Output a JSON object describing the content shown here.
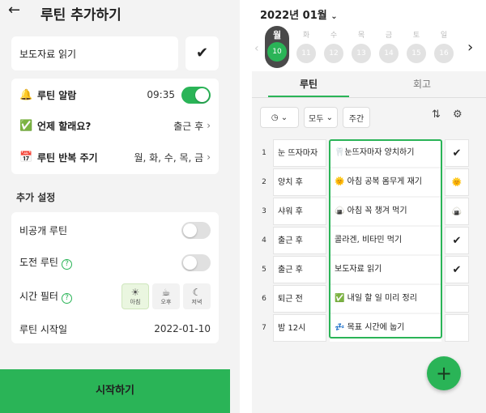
{
  "left": {
    "header": {
      "back_icon": "arrow-left-icon",
      "title": "루틴 추가하기"
    },
    "routine_name": "보도자료 읽기",
    "confirm_icon": "checkmark-icon",
    "settings": [
      {
        "icon": "bell-icon",
        "label": "루틴 알람",
        "value": "09:35",
        "control": "toggle-on"
      },
      {
        "icon": "check-box-icon",
        "label": "언제 할래요?",
        "value": "출근 후"
      },
      {
        "icon": "calendar-icon",
        "label": "루틴 반복 주기",
        "value": "월, 화, 수, 목, 금"
      }
    ],
    "section_title": "추가 설정",
    "extra": {
      "private": {
        "label": "비공개 루틴",
        "on": false
      },
      "challenge": {
        "label": "도전 루틴",
        "on": false
      },
      "time_filter": {
        "label": "시간 필터",
        "options": [
          "아침",
          "오후",
          "저녁"
        ],
        "selected": "아침"
      },
      "start_date": {
        "label": "루틴 시작일",
        "value": "2022-01-10"
      }
    },
    "start_button": "시작하기",
    "colors": {
      "accent": "#2ab457"
    }
  },
  "right": {
    "month": "2022년 01월",
    "days": [
      {
        "label": "월",
        "num": "10",
        "active": true
      },
      {
        "label": "화",
        "num": "11"
      },
      {
        "label": "수",
        "num": "12"
      },
      {
        "label": "목",
        "num": "13"
      },
      {
        "label": "금",
        "num": "14"
      },
      {
        "label": "토",
        "num": "15"
      },
      {
        "label": "일",
        "num": "16"
      }
    ],
    "tabs": [
      "루틴",
      "회고"
    ],
    "filters": [
      "모두",
      "주간"
    ],
    "routines": [
      {
        "num": "1",
        "time": "눈 뜨자마자",
        "task": "🦷눈뜨자마자 양치하기",
        "done": "✔"
      },
      {
        "num": "2",
        "time": "양치 후",
        "task": "🌞 아침 공복 몸무게 재기",
        "done": "🌞"
      },
      {
        "num": "3",
        "time": "샤워 후",
        "task": "🍙 아침 꼭 챙겨 먹기",
        "done": "🍙"
      },
      {
        "num": "4",
        "time": "출근 후",
        "task": "콜라겐, 비타민 먹기",
        "done": "✔"
      },
      {
        "num": "5",
        "time": "출근 후",
        "task": "보도자료 읽기",
        "done": "✔"
      },
      {
        "num": "6",
        "time": "퇴근 전",
        "task": "✅ 내일 할 일 미리 정리",
        "done": ""
      },
      {
        "num": "7",
        "time": "밤 12시",
        "task": "💤 목표 시간에 눕기",
        "done": ""
      }
    ],
    "fab_label": "+"
  }
}
